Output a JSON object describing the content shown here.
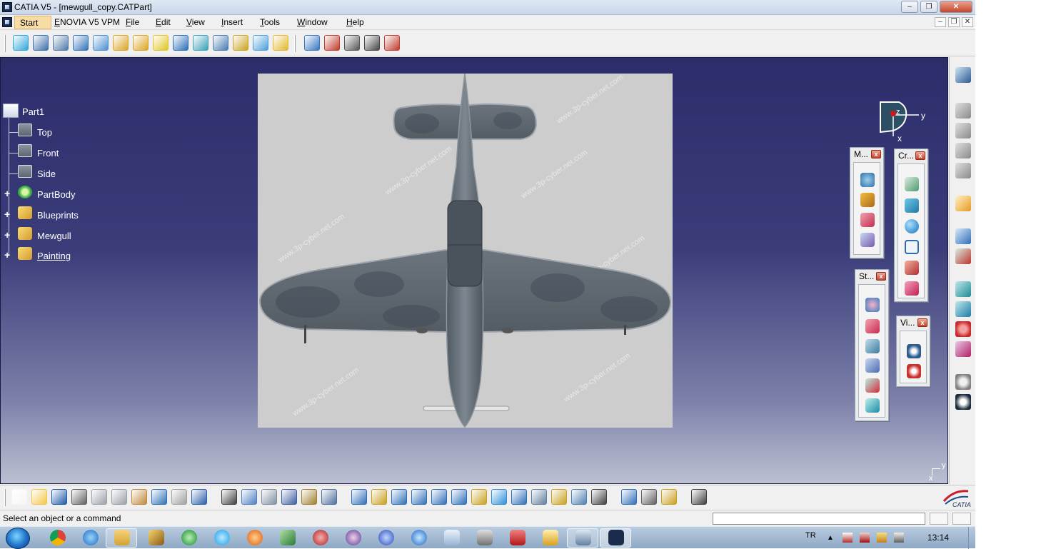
{
  "window": {
    "title": "CATIA V5 - [mewgull_copy.CATPart]",
    "minimize": "–",
    "restore": "❐",
    "close": "✕"
  },
  "menubar": {
    "items": [
      "Start",
      "ENOVIA V5 VPM",
      "File",
      "Edit",
      "View",
      "Insert",
      "Tools",
      "Window",
      "Help"
    ]
  },
  "top_toolbar": {
    "icons": [
      "surface-icon",
      "solid-icon",
      "multi-part-icon",
      "sketch-analysis-icon",
      "wireframe-icon",
      "curve-icon",
      "spline-icon",
      "point-icon",
      "pattern-icon",
      "sweep-icon",
      "blend-icon",
      "join-icon",
      "heal-icon",
      "layers-icon",
      "measure-icon",
      "sections-icon",
      "grid-icon",
      "curvature-icon",
      "draft-icon"
    ],
    "colors": [
      "#2fa6d8",
      "#3d6fa8",
      "#4f78a8",
      "#3172b8",
      "#4a8fcf",
      "#d9a421",
      "#d9a421",
      "#e0c320",
      "#2a6eb8",
      "#3ba0b8",
      "#4a7ab0",
      "#c8a320",
      "#4b9ed8",
      "#e2b82a",
      "#3676c0",
      "#c0392b",
      "#555555",
      "#444444",
      "#c0392b"
    ]
  },
  "tree": {
    "root": "Part1",
    "items": [
      "Top",
      "Front",
      "Side",
      "PartBody",
      "Blueprints",
      "Mewgull",
      "Painting"
    ]
  },
  "compass": {
    "z": "z",
    "y": "y",
    "x": "x"
  },
  "axis_corner": {
    "y": "y",
    "x": "x"
  },
  "watermark_text": "www.3p-cyber.net.com",
  "palettes": {
    "m": {
      "title": "M...",
      "close": "x"
    },
    "cr": {
      "title": "Cr...",
      "close": "x"
    },
    "st": {
      "title": "St...",
      "close": "x"
    },
    "vi": {
      "title": "Vi...",
      "close": "x"
    }
  },
  "bottom_toolbar": {
    "icons": [
      "new-icon",
      "open-icon",
      "save-icon",
      "print-icon",
      "cut-icon",
      "copy-icon",
      "paste-icon",
      "undo-icon",
      "redo-icon",
      "whats-this-icon",
      "formula-icon",
      "comment-icon",
      "design-table-icon",
      "catalog-icon",
      "lock-icon",
      "align-icon",
      "fly-mode-icon",
      "fit-all-icon",
      "pan-icon",
      "rotate-icon",
      "zoom-in-icon",
      "zoom-out-icon",
      "normal-view-icon",
      "multi-view-icon",
      "iso-view-icon",
      "shading-icon",
      "hide-show-icon",
      "swap-visible-icon",
      "update-icon",
      "measure-between-icon",
      "measure-item-icon",
      "inertia-icon",
      "capture-icon"
    ]
  },
  "status": {
    "message": "Select an object or a command"
  },
  "taskbar": {
    "lang": "TR",
    "clock": "13:14"
  }
}
